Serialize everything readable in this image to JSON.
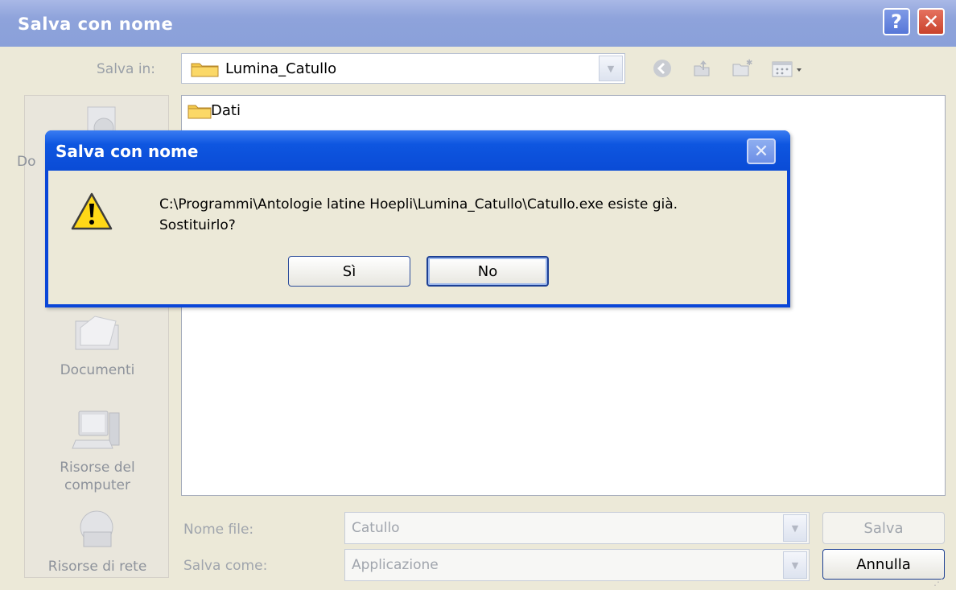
{
  "window": {
    "title": "Salva con nome",
    "help_label": "?",
    "close_label": "✕"
  },
  "toolbar": {
    "save_in_label": "Salva in:",
    "location_value": "Lumina_Catullo",
    "icons": [
      "back-icon",
      "up-folder-icon",
      "new-folder-icon",
      "view-menu-icon"
    ]
  },
  "places": [
    {
      "label": "Do",
      "icon": "documents-icon"
    },
    {
      "label": "Documenti",
      "icon": "folder-icon"
    },
    {
      "label": "Risorse del computer",
      "icon": "my-computer-icon"
    },
    {
      "label": "Risorse di rete",
      "icon": "network-icon"
    }
  ],
  "places_text": {
    "partial_label": "Do",
    "documenti": "Documenti",
    "computer_line1": "Risorse del",
    "computer_line2": "computer",
    "network": "Risorse di rete"
  },
  "files": [
    {
      "name": "Dati",
      "type": "folder"
    }
  ],
  "form": {
    "filename_label": "Nome file:",
    "filename_value": "Catullo",
    "savetype_label": "Salva come:",
    "savetype_value": "Applicazione",
    "save_button": "Salva",
    "cancel_button": "Annulla"
  },
  "dialog": {
    "title": "Salva con nome",
    "message_line1": "C:\\Programmi\\Antologie latine Hoepli\\Lumina_Catullo\\Catullo.exe esiste già.",
    "message_line2": "Sostituirlo?",
    "yes_button": "Sì",
    "no_button": "No",
    "icon": "warning-icon"
  },
  "colors": {
    "dialog_title_blue": "#0a4bd6",
    "inactive_title": "#8ea3db",
    "face": "#ece9d8"
  }
}
